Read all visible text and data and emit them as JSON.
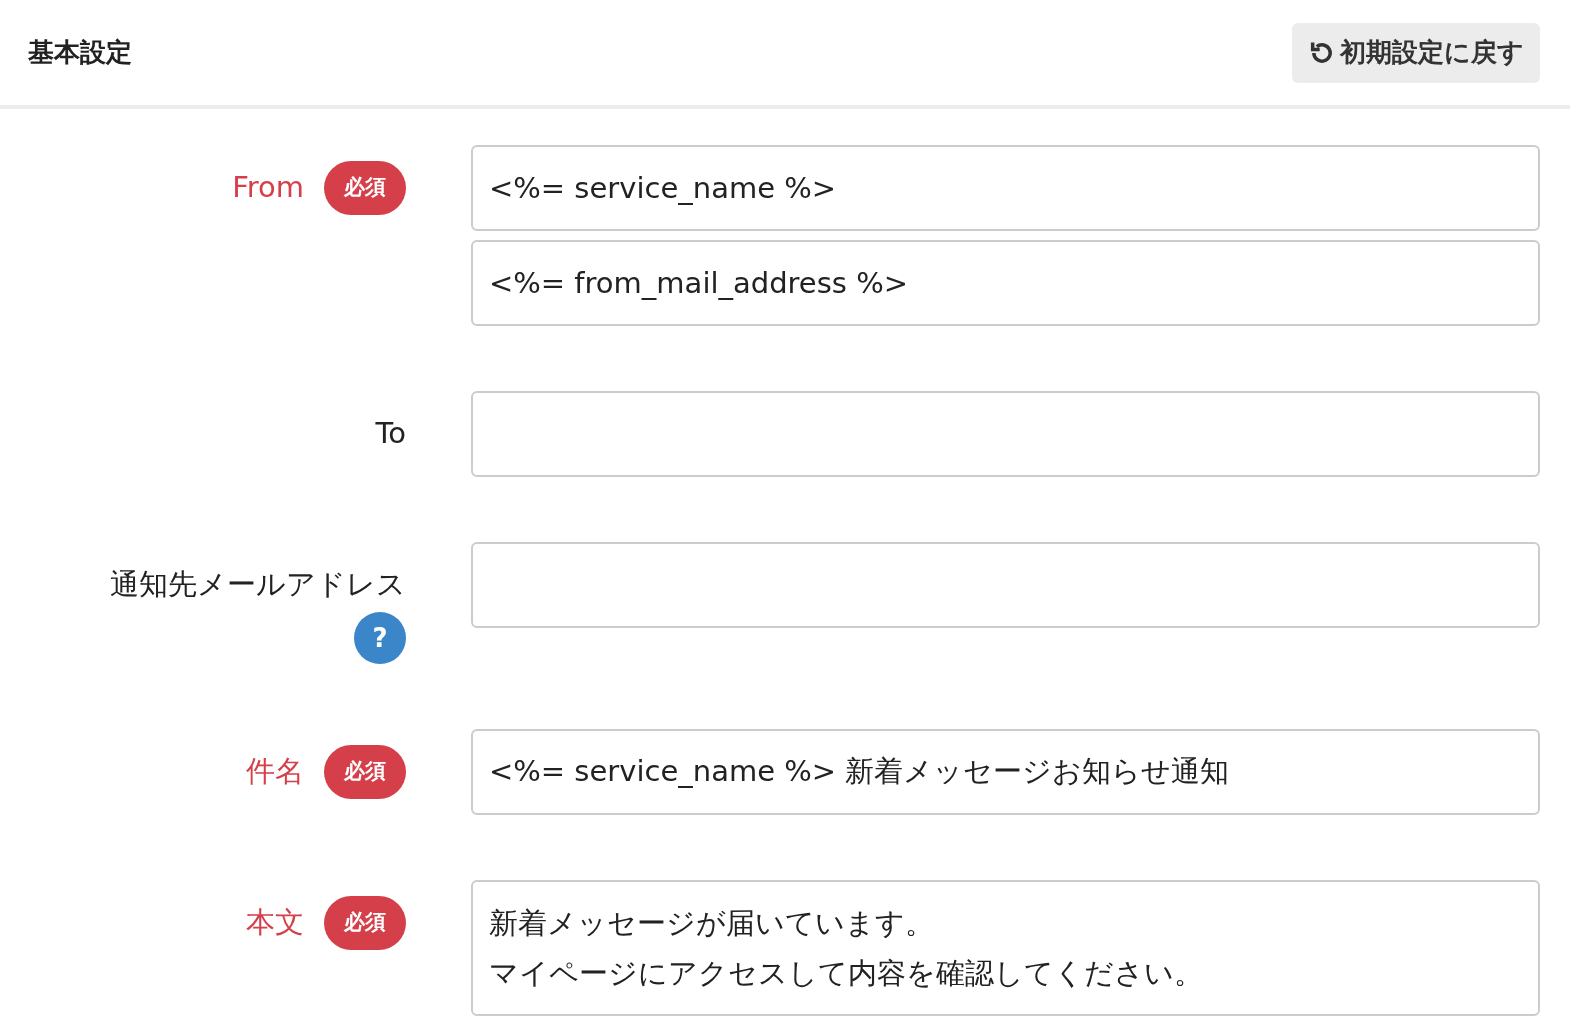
{
  "header": {
    "title": "基本設定",
    "reset_button": "初期設定に戻す"
  },
  "fields": [
    {
      "label": "From",
      "required": true,
      "badge": "必須",
      "kind": "input",
      "inputs": [
        {
          "kind": "text",
          "value": "<%= service_name %>"
        },
        {
          "kind": "text",
          "value": "<%= from_mail_address %>"
        }
      ]
    },
    {
      "label": "To",
      "required": false,
      "kind": "input",
      "inputs": [
        {
          "kind": "text"
        }
      ]
    },
    {
      "label": "通知先メールアドレス",
      "required": false,
      "help": "?",
      "kind": "input",
      "inputs": [
        {
          "kind": "text"
        }
      ]
    },
    {
      "label": "件名",
      "required": true,
      "badge": "必須",
      "kind": "input",
      "inputs": [
        {
          "kind": "text",
          "value": "<%= service_name %> 新着メッセージお知らせ通知"
        }
      ]
    },
    {
      "label": "本文",
      "required": true,
      "badge": "必須",
      "kind": "textarea",
      "lines": [
        "新着メッセージが届いています。",
        "マイページにアクセスして内容を確認してください。"
      ]
    }
  ]
}
